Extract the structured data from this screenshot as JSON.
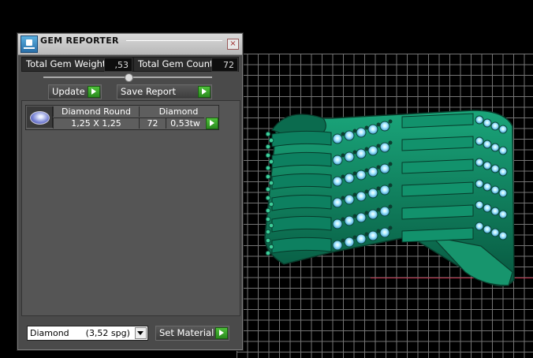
{
  "dialog": {
    "title": "GEM REPORTER",
    "close_glyph": "×"
  },
  "stats": {
    "weight_label": "Total Gem Weight",
    "weight_value": ",53",
    "count_label": "Total Gem Count",
    "count_value": "72"
  },
  "actions": {
    "update_label": "Update",
    "save_label": "Save Report"
  },
  "gems": [
    {
      "shape": "Diamond Round",
      "material": "Diamond",
      "size": "1,25 X 1,25",
      "count": "72",
      "weight": "0,53tw"
    }
  ],
  "material_select": {
    "value": "Diamond      (3,52 spg)"
  },
  "set_material_label": "Set Material",
  "icons": {
    "app": "gem-reporter-app-icon",
    "close": "close-icon",
    "go": "play-arrow-icon",
    "gem": "round-gem-icon",
    "dropdown": "chevron-down-icon"
  },
  "colors": {
    "model": "#0f7a5a",
    "gem_highlight": "#9fe8ff",
    "go_button": "#3aa52a",
    "grid": "#8a8a8a"
  }
}
